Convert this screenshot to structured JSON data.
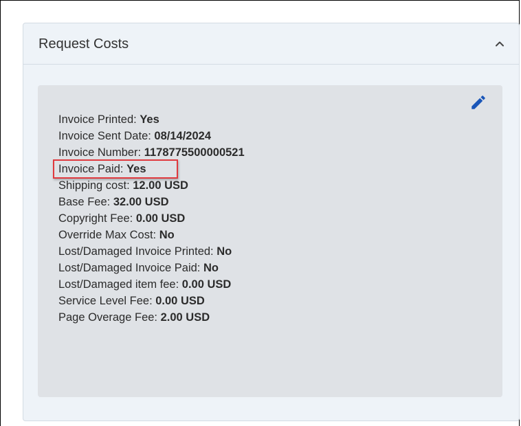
{
  "panel": {
    "title": "Request Costs"
  },
  "colors": {
    "accent": "#1a56b8",
    "highlight": "#e0393e",
    "panel_bg": "#eef3f8",
    "card_bg": "#dfe2e6"
  },
  "icons": {
    "collapse": "chevron-up-icon",
    "edit": "pencil-icon"
  },
  "fields": [
    {
      "label": "Invoice Printed:",
      "value": "Yes"
    },
    {
      "label": "Invoice Sent Date:",
      "value": "08/14/2024"
    },
    {
      "label": "Invoice Number:",
      "value": "1178775500000521"
    },
    {
      "label": "Invoice Paid:",
      "value": "Yes"
    },
    {
      "label": "Shipping cost:",
      "value": "12.00 USD"
    },
    {
      "label": "Base Fee:",
      "value": "32.00 USD"
    },
    {
      "label": "Copyright Fee:",
      "value": "0.00 USD"
    },
    {
      "label": "Override Max Cost:",
      "value": "No"
    },
    {
      "label": "Lost/Damaged Invoice Printed:",
      "value": "No"
    },
    {
      "label": "Lost/Damaged Invoice Paid:",
      "value": "No"
    },
    {
      "label": "Lost/Damaged item fee:",
      "value": "0.00 USD"
    },
    {
      "label": "Service Level Fee:",
      "value": "0.00 USD"
    },
    {
      "label": "Page Overage Fee:",
      "value": "2.00 USD"
    }
  ]
}
